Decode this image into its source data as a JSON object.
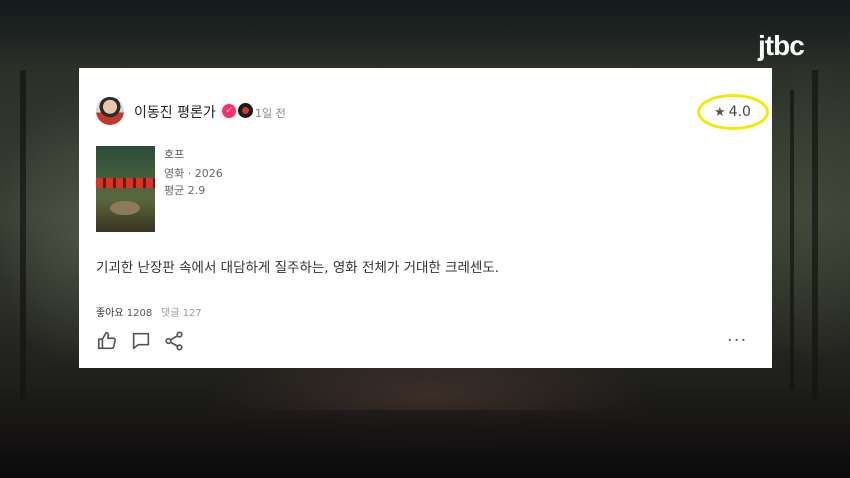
{
  "broadcaster": {
    "logo": "jtbc"
  },
  "post": {
    "author": "이동진 평론가",
    "time_ago": "1일 전",
    "rating": "4.0",
    "movie": {
      "title": "호프",
      "meta": "영화 · 2026",
      "average": "평균 2.9"
    },
    "review": "기괴한 난장판 속에서 대담하게 질주하는, 영화 전체가 거대한 크레센도.",
    "likes_label": "좋아요",
    "likes_count": "1208",
    "comments": "댓글 127",
    "more": "···"
  },
  "colors": {
    "rating_highlight": "#f4ea00",
    "verified": "#ff2f6e"
  },
  "icons": [
    "star-icon",
    "verified-icon",
    "badge-icon",
    "thumb-up-icon",
    "comment-icon",
    "share-icon",
    "more-icon"
  ]
}
